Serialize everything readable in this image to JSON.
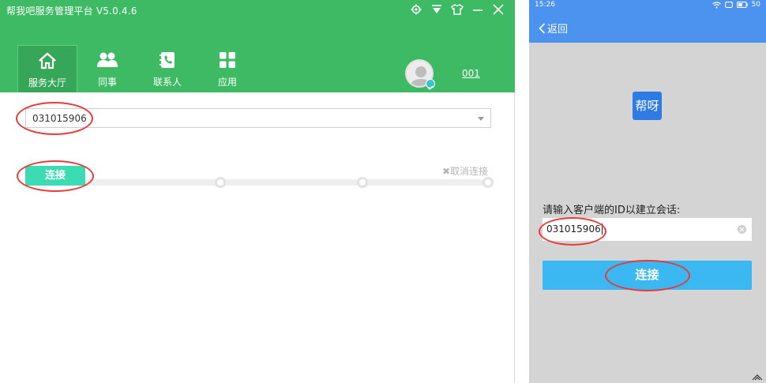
{
  "desktop": {
    "title": "帮我吧服务管理平台  V5.0.4.6",
    "window_controls": [
      "settings-icon",
      "dropdown-icon",
      "skin-icon",
      "minimize-icon",
      "close-icon"
    ],
    "tabs": [
      {
        "label": "服务大厅",
        "icon": "home-icon",
        "active": true
      },
      {
        "label": "同事",
        "icon": "colleagues-icon",
        "active": false
      },
      {
        "label": "联系人",
        "icon": "contacts-icon",
        "active": false
      },
      {
        "label": "应用",
        "icon": "apps-icon",
        "active": false
      }
    ],
    "user_id": "001",
    "id_field_value": "031015906",
    "connect_label": "连接",
    "cancel_label": "✖取消连接",
    "colors": {
      "header": "#3dba63",
      "connect": "#3ddbb3",
      "highlight": "#e83a3a"
    }
  },
  "phone": {
    "time": "15:26",
    "battery": "50",
    "back_label": "返回",
    "app_logo_text": "帮呀",
    "prompt": "请输入客户端的ID以建立会话:",
    "id_value": "031015906",
    "connect_label": "连接",
    "colors": {
      "bar": "#4b93ef",
      "button": "#3bb8f2",
      "logo": "#2f7be5"
    }
  }
}
